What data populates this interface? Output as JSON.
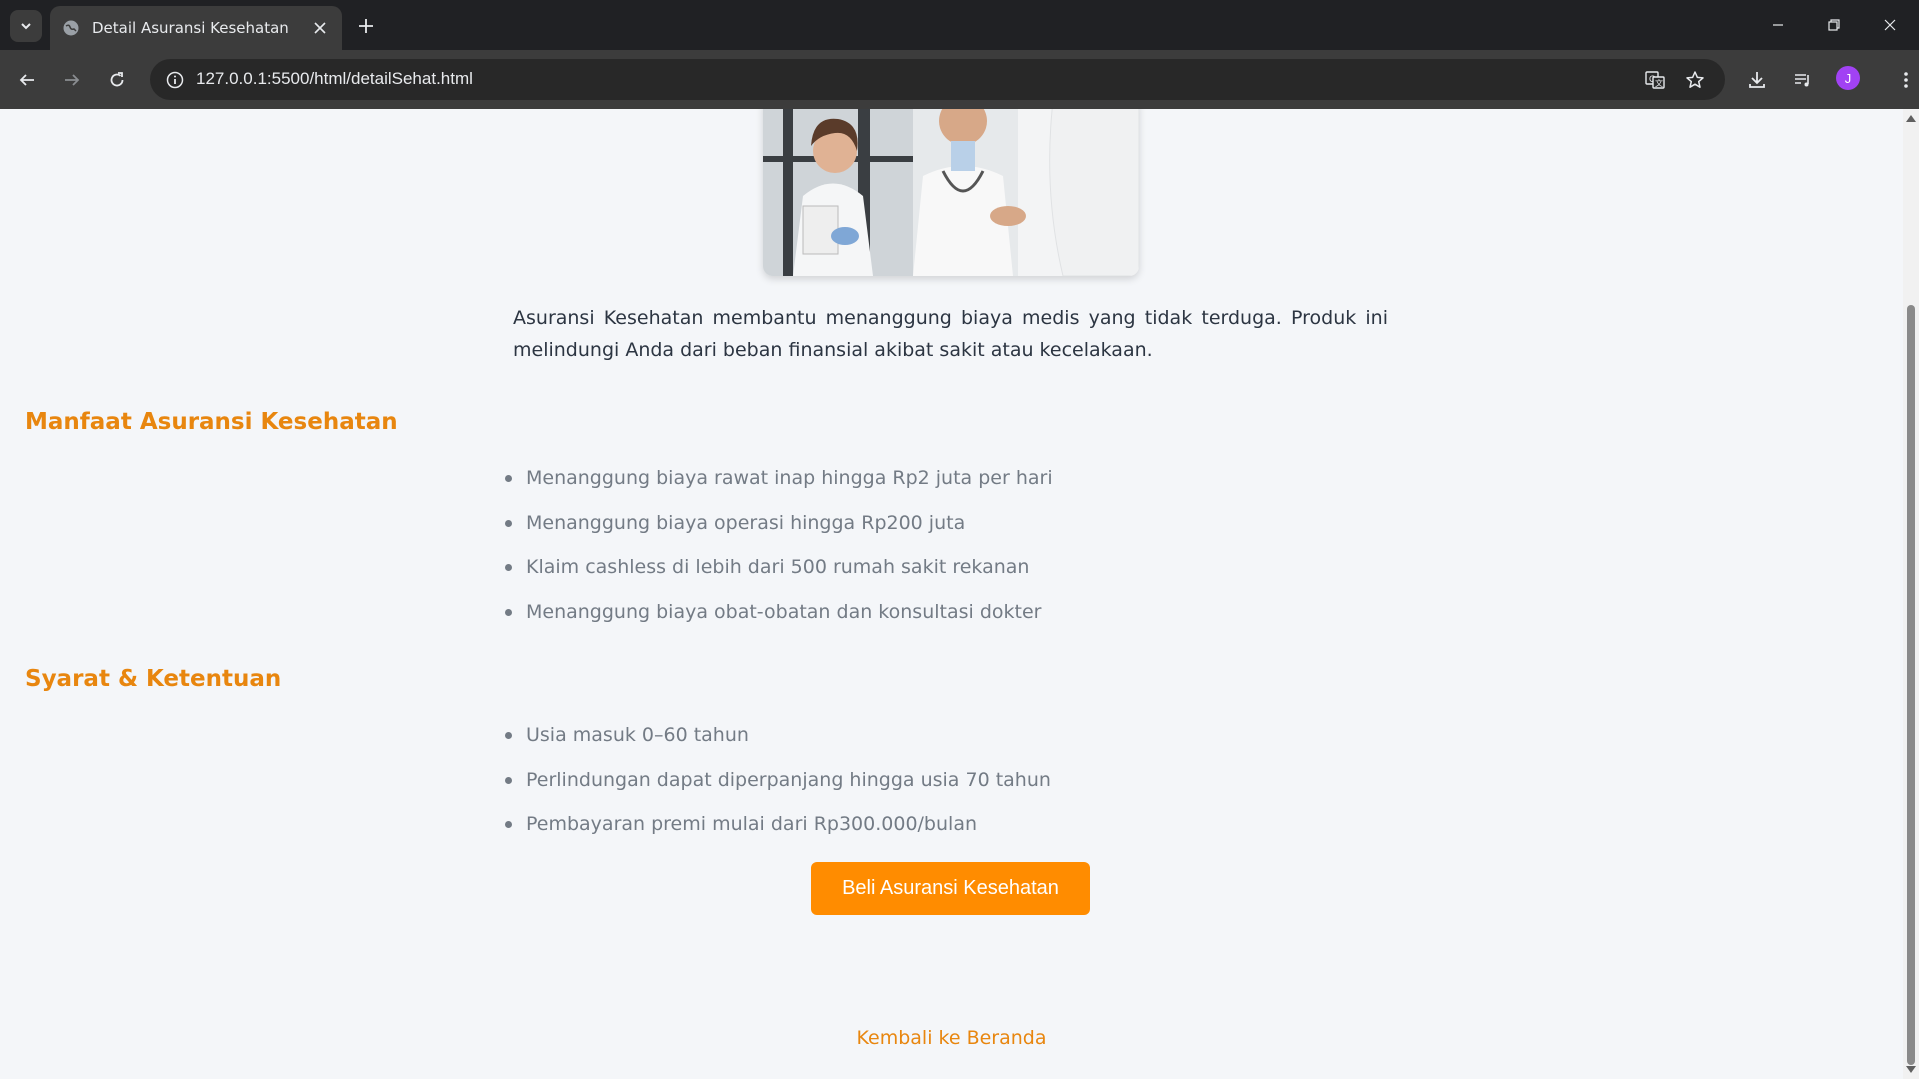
{
  "browser": {
    "tab_title": "Detail Asuransi Kesehatan",
    "url": "127.0.0.1:5500/html/detailSehat.html",
    "profile_initial": "J"
  },
  "page": {
    "intro": "Asuransi Kesehatan membantu menanggung biaya medis yang tidak terduga. Produk ini melindungi Anda dari beban finansial akibat sakit atau kecelakaan.",
    "benefits": {
      "title": "Manfaat Asuransi Kesehatan",
      "items": [
        "Menanggung biaya rawat inap hingga Rp2 juta per hari",
        "Menanggung biaya operasi hingga Rp200 juta",
        "Klaim cashless di lebih dari 500 rumah sakit rekanan",
        "Menanggung biaya obat-obatan dan konsultasi dokter"
      ]
    },
    "terms": {
      "title": "Syarat & Ketentuan",
      "items": [
        "Usia masuk 0–60 tahun",
        "Perlindungan dapat diperpanjang hingga usia 70 tahun",
        "Pembayaran premi mulai dari Rp300.000/bulan"
      ]
    },
    "buy_button": "Beli Asuransi Kesehatan",
    "back_link": "Kembali ke Beranda"
  },
  "colors": {
    "accent": "#ff8c00",
    "heading": "#e8860f",
    "page_bg": "#f4f6f9"
  }
}
